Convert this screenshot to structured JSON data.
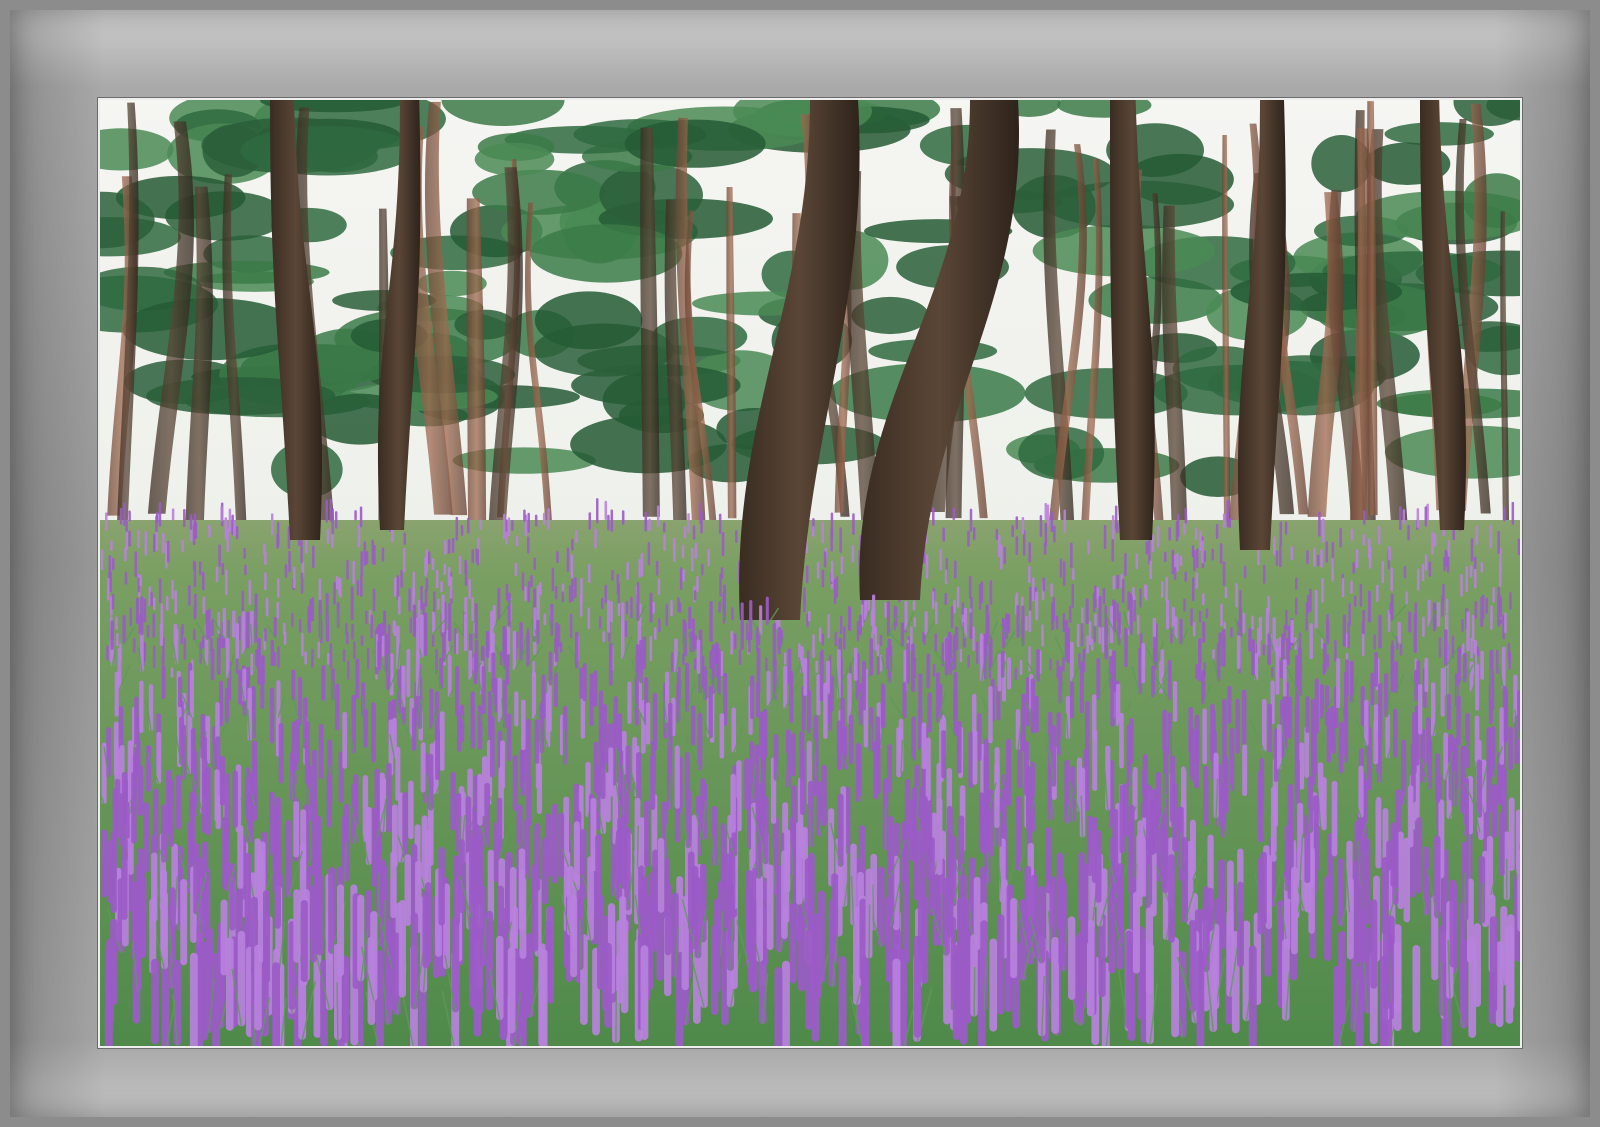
{
  "image": {
    "subject": "pine-forest-with-purple-flower-field",
    "colors": {
      "frame": "#9a9a9a",
      "sky": "#f2f2f0",
      "canopy": "#2f6a3f",
      "trunk": "#4a3a2e",
      "trunk_reddish": "#8a5a44",
      "flowers": "#9b5bc7",
      "flowers_light": "#b981dd",
      "foliage": "#5f9a58"
    }
  }
}
